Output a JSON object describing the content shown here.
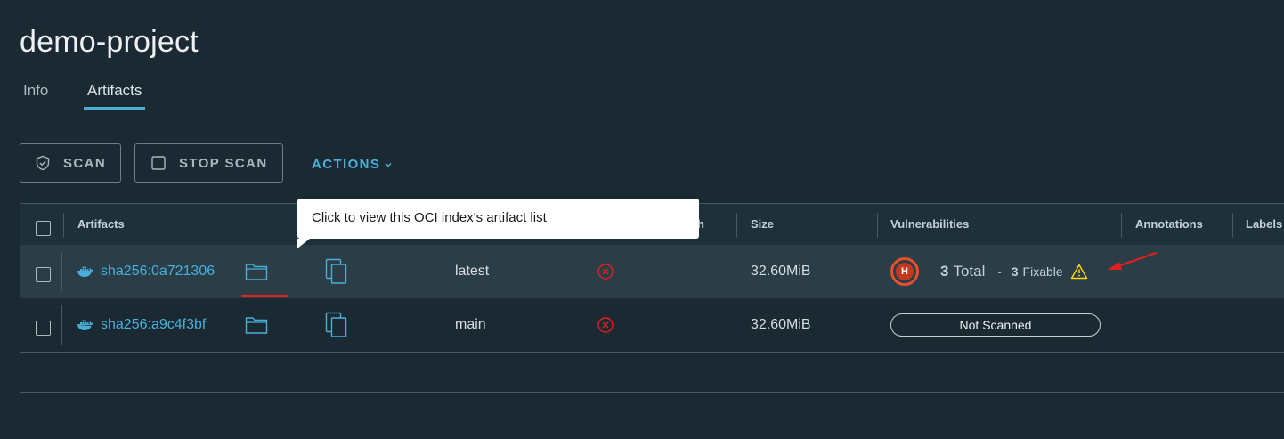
{
  "project": {
    "title": "demo-project"
  },
  "tabs": [
    {
      "label": "Info",
      "active": false
    },
    {
      "label": "Artifacts",
      "active": true
    }
  ],
  "toolbar": {
    "scan_label": "SCAN",
    "stop_scan_label": "STOP SCAN",
    "actions_label": "ACTIONS"
  },
  "table": {
    "columns": [
      "Artifacts",
      "Size",
      "Vulnerabilities",
      "Annotations",
      "Labels"
    ],
    "partial_column_suffix": "h",
    "rows": [
      {
        "digest": "sha256:0a721306",
        "tag": "latest",
        "size": "32.60MiB",
        "vuln": {
          "severity_letter": "H",
          "total_count": "3",
          "total_label": "Total",
          "separator": "-",
          "fixable_count": "3",
          "fixable_label": "Fixable"
        }
      },
      {
        "digest": "sha256:a9c4f3bf",
        "tag": "main",
        "size": "32.60MiB",
        "vuln_status": "Not Scanned"
      }
    ]
  },
  "tooltip": {
    "text": "Click to view this OCI index's artifact list"
  },
  "colors": {
    "background": "#1b2a32",
    "accent": "#49afd9",
    "error": "#e0211d",
    "severity_high": "#e8502b",
    "warning": "#ffd700"
  },
  "icons": [
    "shield-check-icon",
    "checkbox-icon",
    "chevron-down-icon",
    "docker-whale-icon",
    "folder-icon",
    "copy-icon",
    "error-circle-icon",
    "warning-triangle-icon",
    "red-arrow-annotation"
  ]
}
